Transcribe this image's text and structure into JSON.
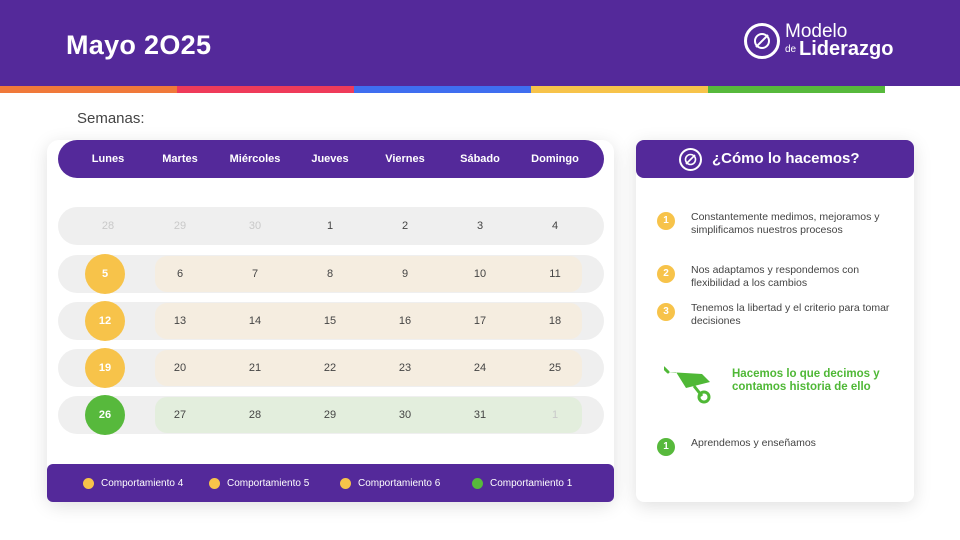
{
  "page": {
    "title": "Mayo 2O25",
    "logo": {
      "line1": "Modelo",
      "small": "de",
      "line2": "Liderazgo"
    },
    "stripe_colors": [
      "#f0793a",
      "#ef3b5a",
      "#3f6ef0",
      "#f7c34a",
      "#57b93c"
    ]
  },
  "calendar": {
    "label": "Semanas:",
    "days": [
      "Lunes",
      "Martes",
      "Miércoles",
      "Jueves",
      "Viernes",
      "Sábado",
      "Domingo"
    ],
    "weeks": [
      {
        "highlight": "none",
        "circle_color": "",
        "dates": [
          "28",
          "29",
          "30",
          "1",
          "2",
          "3",
          "4"
        ],
        "muted": [
          true,
          true,
          true,
          false,
          false,
          false,
          false
        ]
      },
      {
        "highlight": "beige",
        "circle_color": "#f7c34a",
        "dates": [
          "5",
          "6",
          "7",
          "8",
          "9",
          "10",
          "11"
        ],
        "muted": [
          false,
          false,
          false,
          false,
          false,
          false,
          false
        ]
      },
      {
        "highlight": "beige",
        "circle_color": "#f7c34a",
        "dates": [
          "12",
          "13",
          "14",
          "15",
          "16",
          "17",
          "18"
        ],
        "muted": [
          false,
          false,
          false,
          false,
          false,
          false,
          false
        ]
      },
      {
        "highlight": "beige",
        "circle_color": "#f7c34a",
        "dates": [
          "19",
          "20",
          "21",
          "22",
          "23",
          "24",
          "25"
        ],
        "muted": [
          false,
          false,
          false,
          false,
          false,
          false,
          false
        ]
      },
      {
        "highlight": "green",
        "circle_color": "#57b93c",
        "dates": [
          "26",
          "27",
          "28",
          "29",
          "30",
          "31",
          "1"
        ],
        "muted": [
          false,
          false,
          false,
          false,
          false,
          false,
          true
        ]
      }
    ],
    "legend": [
      {
        "label": "Comportamiento 4",
        "color": "#f7c34a"
      },
      {
        "label": "Comportamiento 5",
        "color": "#f7c34a"
      },
      {
        "label": "Comportamiento 6",
        "color": "#f7c34a"
      },
      {
        "label": "Comportamiento 1",
        "color": "#57b93c"
      }
    ]
  },
  "side_panel": {
    "title": "¿Cómo lo hacemos?",
    "steps": [
      {
        "num": "1",
        "text": "Constantemente medimos, mejoramos y simplificamos nuestros procesos",
        "color": "#f7c34a"
      },
      {
        "num": "2",
        "text": "Nos adaptamos y respondemos con flexibilidad a los cambios",
        "color": "#f7c34a"
      },
      {
        "num": "3",
        "text": "Tenemos la libertad y el criterio para tomar decisiones",
        "color": "#f7c34a"
      }
    ],
    "callout": "Hacemos lo que decimos y contamos historia de ello",
    "callout_icon": "wheelbarrow-icon",
    "extra_step": {
      "num": "1",
      "text": "Aprendemos y enseñamos",
      "color": "#57b93c"
    }
  }
}
